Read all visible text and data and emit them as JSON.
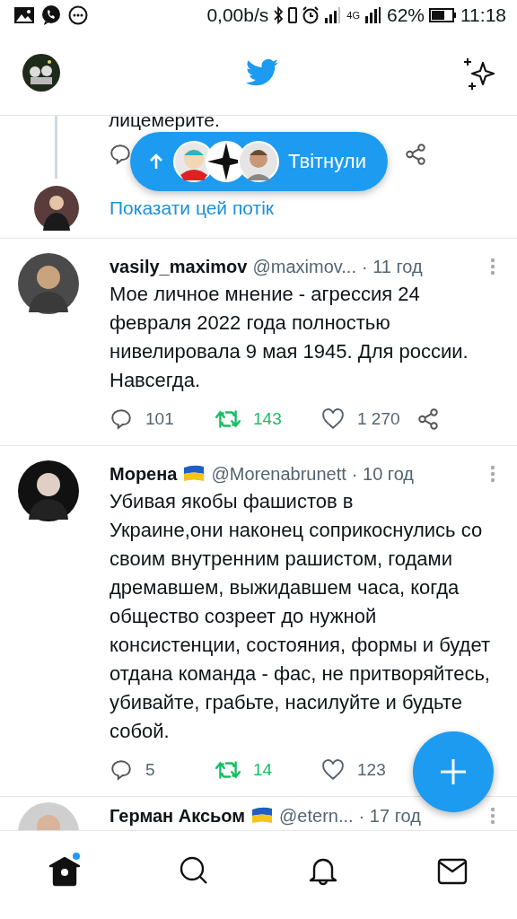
{
  "status_bar": {
    "speed": "0,00b/s",
    "network": "4G",
    "battery": "62%",
    "time": "11:18"
  },
  "previous_tweet": {
    "text_end": "лицемерите.",
    "show_thread": "Показати цей потік"
  },
  "retweeted_pill": {
    "label": "Твітнули"
  },
  "tweets": [
    {
      "name": "vasily_maximov",
      "flag": false,
      "handle": "@maximov...",
      "time": "· 11 год",
      "text": "Мое личное мнение - агрессия 24 февраля 2022 года полностью нивелировала 9 мая 1945. Для россии. Навсегда.",
      "replies": "101",
      "retweets": "143",
      "likes": "1 270",
      "retweeted": true,
      "liked": false,
      "share": true
    },
    {
      "name": "Морена",
      "flag": true,
      "handle": "@Morenabrunett",
      "time": "· 10 год",
      "text": "Убивая якобы фашистов в\nУкраине,они наконец соприкоснулись со своим внутренним рашистом, годами дремавшем, выжидавшем часа, когда общество созреет до нужной консистенции, состояния, формы и будет отдана команда - фас, не притворяйтесь, убивайте, грабьте, насилуйте и будьте собой.",
      "replies": "5",
      "retweets": "14",
      "likes": "123",
      "retweeted": true,
      "liked": false,
      "share": false
    },
    {
      "name": "Герман Аксьом",
      "flag": true,
      "handle": "@etern...",
      "time": "· 17 год"
    }
  ],
  "tab_bar": [
    {
      "kind": "home",
      "selected": true,
      "badge": true
    },
    {
      "kind": "search",
      "selected": false,
      "badge": false
    },
    {
      "kind": "notifications",
      "selected": false,
      "badge": false
    },
    {
      "kind": "messages",
      "selected": false,
      "badge": false
    }
  ]
}
